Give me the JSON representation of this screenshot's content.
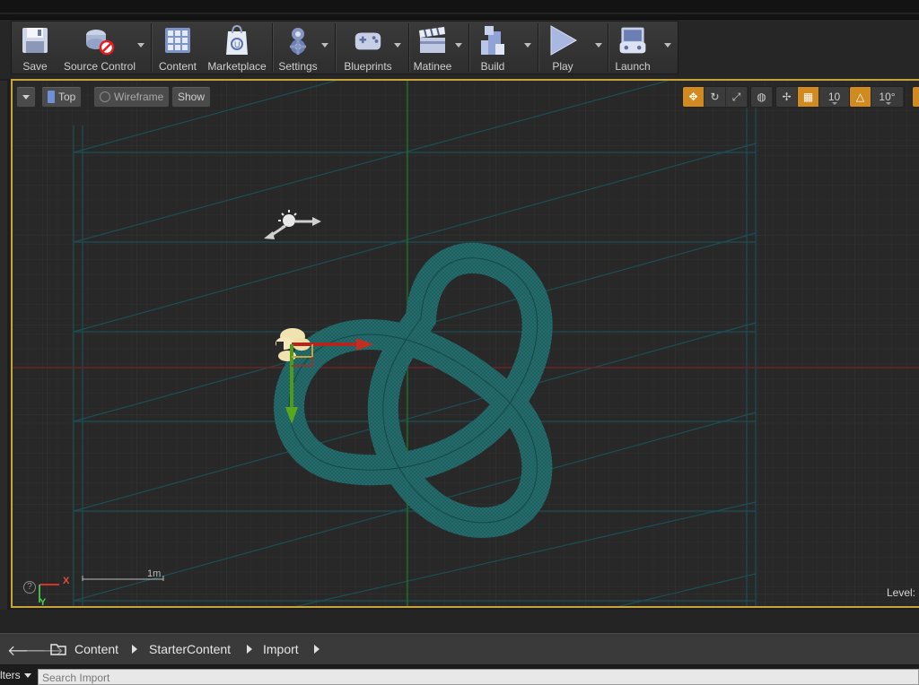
{
  "toolbar": {
    "items": [
      {
        "label": "Save",
        "icon": "save-icon",
        "has_dropdown": false
      },
      {
        "label": "Source Control",
        "icon": "source-control-icon",
        "has_dropdown": true
      },
      {
        "label": "Content",
        "icon": "content-icon",
        "has_dropdown": false
      },
      {
        "label": "Marketplace",
        "icon": "marketplace-icon",
        "has_dropdown": false
      },
      {
        "label": "Settings",
        "icon": "settings-icon",
        "has_dropdown": true
      },
      {
        "label": "Blueprints",
        "icon": "blueprints-icon",
        "has_dropdown": true
      },
      {
        "label": "Matinee",
        "icon": "matinee-icon",
        "has_dropdown": true
      },
      {
        "label": "Build",
        "icon": "build-icon",
        "has_dropdown": true
      },
      {
        "label": "Play",
        "icon": "play-icon",
        "has_dropdown": true
      },
      {
        "label": "Launch",
        "icon": "launch-icon",
        "has_dropdown": true
      }
    ]
  },
  "viewport": {
    "view_label": "Top",
    "mode_label": "Wireframe",
    "show_label": "Show",
    "grid_snap_value": "10",
    "rotation_snap_value": "10°",
    "level_label": "Level:",
    "scale_label": "1m",
    "axis_x_label": "X",
    "axis_y_label": "Y",
    "help_glyph": "?",
    "accent_color": "#d08a1f",
    "selection_border_color": "#c8a23a",
    "mesh_color": "#1f6b6b"
  },
  "content_browser": {
    "breadcrumbs": [
      "Content",
      "StarterContent",
      "Import"
    ],
    "filters_label": "lters",
    "search_placeholder": "Search Import"
  }
}
